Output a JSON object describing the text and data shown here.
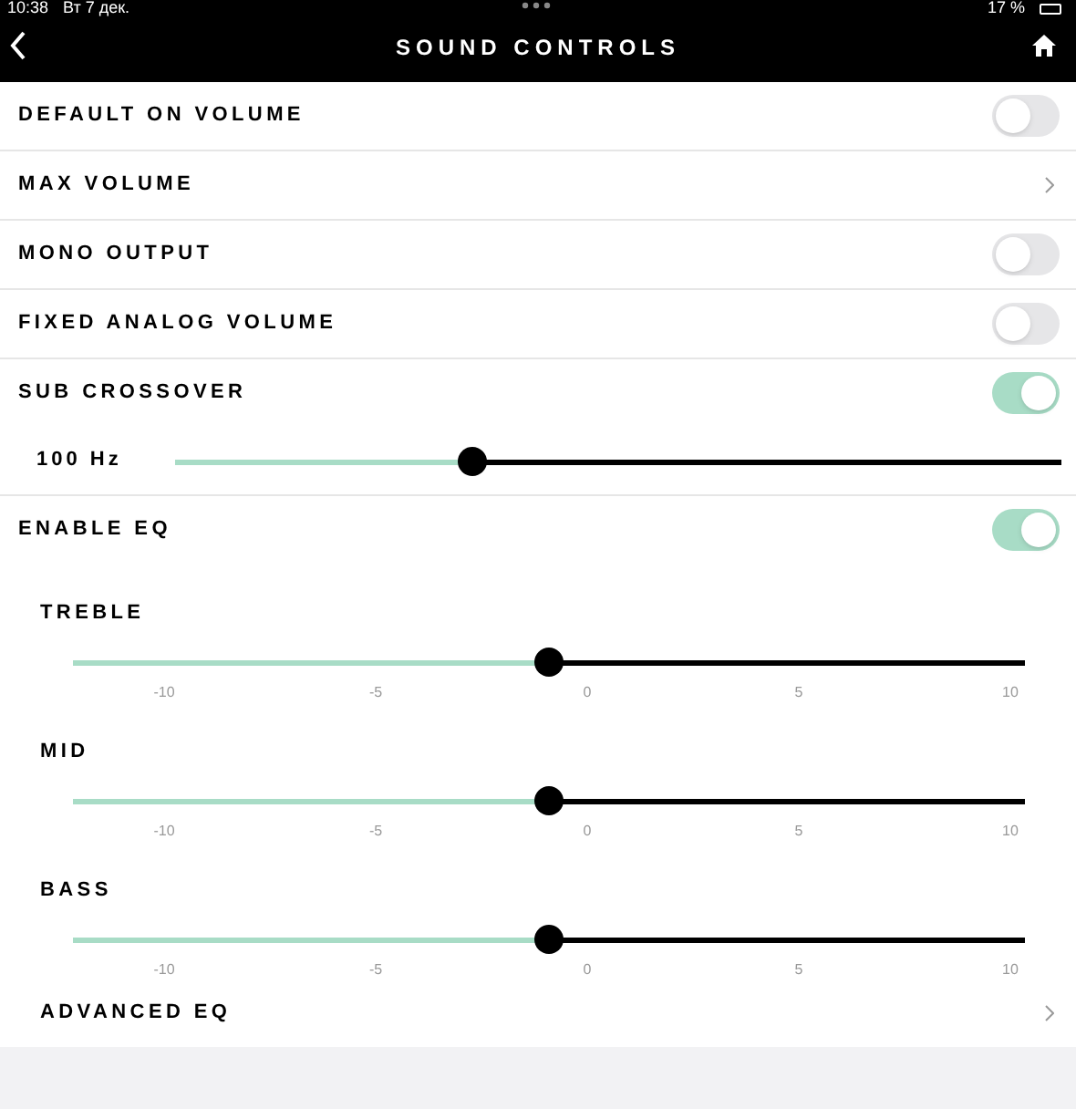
{
  "status_bar": {
    "time": "10:38",
    "date": "Вт 7 дек.",
    "battery": "17 %"
  },
  "nav": {
    "title": "SOUND CONTROLS"
  },
  "rows": [
    {
      "kind": "toggle",
      "label": "DEFAULT ON VOLUME",
      "on": false
    },
    {
      "kind": "link",
      "label": "MAX VOLUME"
    },
    {
      "kind": "toggle",
      "label": "MONO OUTPUT",
      "on": false
    },
    {
      "kind": "toggle",
      "label": "FIXED ANALOG VOLUME",
      "on": false
    },
    {
      "kind": "toggle",
      "label": "SUB CROSSOVER",
      "on": true
    },
    {
      "kind": "slider",
      "reading": "100 Hz",
      "level": 0.335
    },
    {
      "kind": "toggle",
      "label": "ENABLE EQ",
      "on": true
    },
    {
      "kind": "band",
      "label": "TREBLE",
      "level": 0.5,
      "ticks": [
        "-10",
        "-5",
        "0",
        "5",
        "10"
      ]
    },
    {
      "kind": "band",
      "label": "MID",
      "level": 0.5,
      "ticks": [
        "-10",
        "-5",
        "0",
        "5",
        "10"
      ]
    },
    {
      "kind": "band",
      "label": "BASS",
      "level": 0.5,
      "ticks": [
        "-10",
        "-5",
        "0",
        "5",
        "10"
      ]
    },
    {
      "kind": "link",
      "label": "ADVANCED EQ"
    }
  ]
}
